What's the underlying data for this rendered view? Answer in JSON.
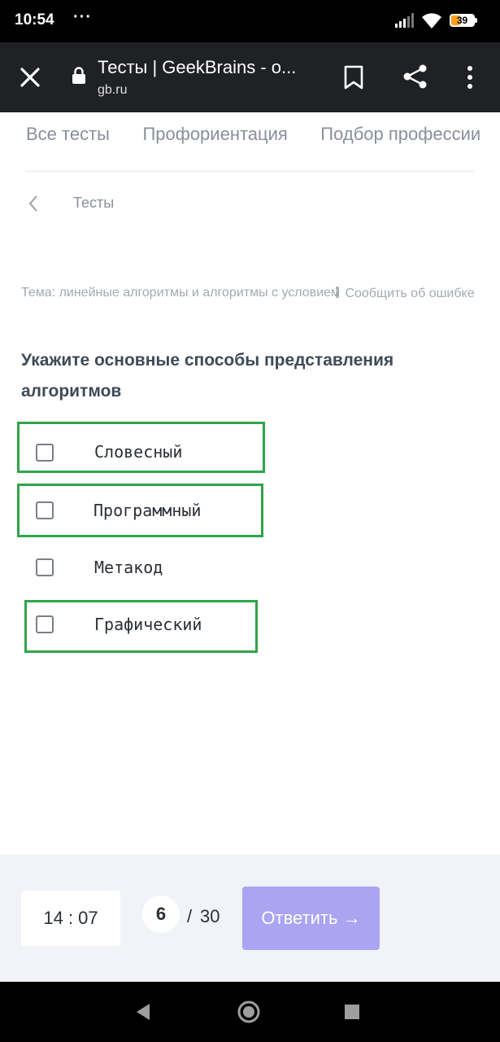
{
  "status_bar": {
    "time": "10:54",
    "dots": "···",
    "battery": "39",
    "icons": [
      "signal-icon",
      "wifi-icon",
      "battery-icon"
    ]
  },
  "browser": {
    "title": "Тесты | GeekBrains - о...",
    "domain": "gb.ru",
    "icons": [
      "close-icon",
      "lock-icon",
      "bookmark-icon",
      "share-icon",
      "more-icon"
    ]
  },
  "nav_tabs": [
    "Все тесты",
    "Профориентация",
    "Подбор профессии"
  ],
  "breadcrumb": {
    "label": "Тесты"
  },
  "topic": "Тема: линейные алгоритмы и алгоритмы с условием",
  "report_link": "Сообщить об ошибке",
  "question": "Укажите основные способы представления алгоритмов",
  "options": [
    {
      "label": "Словесный",
      "checked": false,
      "highlighted": true
    },
    {
      "label": "Программный",
      "checked": false,
      "highlighted": true
    },
    {
      "label": "Метакод",
      "checked": false,
      "highlighted": false
    },
    {
      "label": "Графический",
      "checked": false,
      "highlighted": true
    }
  ],
  "footer": {
    "timer": "14 : 07",
    "current_question": "6",
    "separator": "/",
    "total_questions": "30",
    "answer_button": "Ответить →"
  },
  "colors": {
    "highlight": "#2fa54a",
    "answer_button": "#aba4f2",
    "footer_bg": "#f2f3f8"
  }
}
